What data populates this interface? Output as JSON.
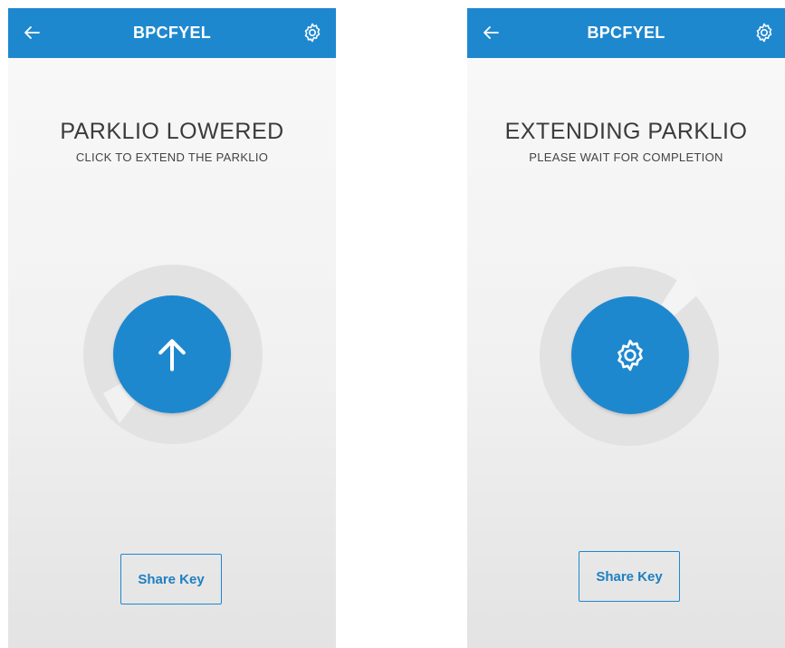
{
  "colors": {
    "primary": "#1e88cf",
    "ring": "#e2e2e2",
    "text": "#3b3b3b"
  },
  "screens": [
    {
      "appbar": {
        "title": "BPCFYEL",
        "back_icon": "arrow-left-icon",
        "settings_icon": "gear-icon"
      },
      "status": {
        "headline": "PARKLIO LOWERED",
        "subline": "CLICK TO EXTEND THE PARKLIO"
      },
      "action_icon": "arrow-up-icon",
      "share_label": "Share Key"
    },
    {
      "appbar": {
        "title": "BPCFYEL",
        "back_icon": "arrow-left-icon",
        "settings_icon": "gear-icon"
      },
      "status": {
        "headline": "EXTENDING PARKLIO",
        "subline": "PLEASE WAIT FOR COMPLETION"
      },
      "action_icon": "gear-icon",
      "share_label": "Share Key"
    }
  ]
}
